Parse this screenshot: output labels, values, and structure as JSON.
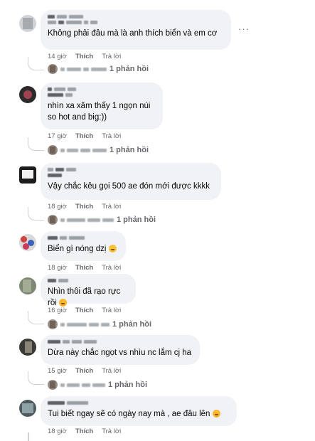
{
  "more_icon": "ellipsis-icon",
  "comments": [
    {
      "text": "Không phải đâu mà là anh thích biển và em cơ",
      "time": "14 giờ",
      "like": "Thích",
      "reply": "Trả lời",
      "reply_count": "1 phản hồi"
    },
    {
      "text": "nhìn xa xăm thấy 1 ngọn núi\nso hot and big:))",
      "time": "17 giờ",
      "like": "Thích",
      "reply": "Trả lời",
      "reply_count": "1 phản hồi"
    },
    {
      "text": "Vậy chắc kêu gọi 500 ae đón mới được kkkk",
      "time": "18 giờ",
      "like": "Thích",
      "reply": "Trả lời",
      "reply_count": "1 phản hồi"
    },
    {
      "text": "Biển gì nóng dzị",
      "emoji": "smile-emoji",
      "time": "18 giờ",
      "like": "Thích",
      "reply": "Trả lời"
    },
    {
      "text": "Nhìn thôi đã rạo rực rồi",
      "emoji": "laughing-emoji",
      "time": "16 giờ",
      "like": "Thích",
      "reply": "Trả lời",
      "reply_count": "1 phản hồi"
    },
    {
      "text": "Dừa này chắc ngọt vs nhìu nc lắm cj ha",
      "time": "15 giờ",
      "like": "Thích",
      "reply": "Trả lời",
      "reply_count": "1 phản hồi"
    },
    {
      "text": "Tui biết ngay sẽ có ngày nay mà , ae đâu lên",
      "emoji": "laughing-emoji",
      "time": "18 giờ",
      "like": "Thích",
      "reply": "Trả lời"
    }
  ]
}
